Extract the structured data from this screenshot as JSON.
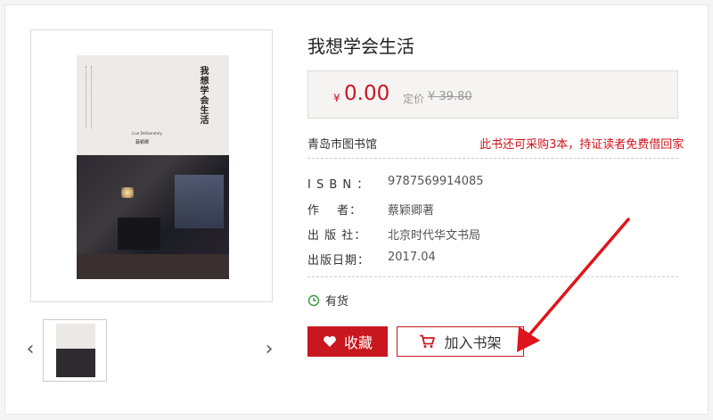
{
  "book": {
    "title": "我想学会生活",
    "currency_symbol": "¥",
    "price": "0.00",
    "list_price_label": "定价",
    "list_price": "¥ 39.80"
  },
  "cover": {
    "title": "我想学会生活",
    "subtitle_en": "Live Deliberately",
    "author": "蔡颖卿"
  },
  "library": {
    "name": "青岛市图书馆",
    "notice": "此书还可采购3本，持证读者免费借回家"
  },
  "meta": [
    {
      "label": "I S B N ：",
      "value": "9787569914085"
    },
    {
      "label": "作　 者：",
      "value": "蔡颖卿著"
    },
    {
      "label": "出 版 社：",
      "value": "北京时代华文书局"
    },
    {
      "label": "出版日期：",
      "value": "2017.04"
    }
  ],
  "stock": {
    "label": "有货",
    "icon": "clock-icon"
  },
  "actions": {
    "favorite_label": "收藏",
    "favorite_icon": "heart-icon",
    "cart_label": "加入书架",
    "cart_icon": "cart-icon"
  },
  "gallery": {
    "prev_icon": "chevron-left-icon",
    "next_icon": "chevron-right-icon"
  },
  "colors": {
    "accent": "#c8171f",
    "price": "#c81623",
    "notice": "#d0121b"
  }
}
